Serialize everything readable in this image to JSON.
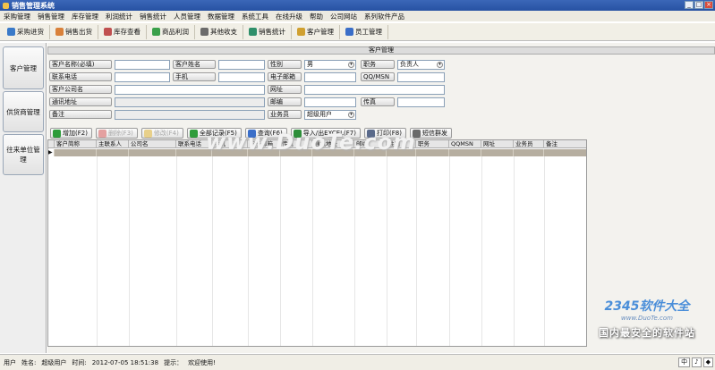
{
  "window": {
    "title": "销售管理系统",
    "buttons": [
      "_",
      "□",
      "×"
    ]
  },
  "menu": [
    "采购管理",
    "销售管理",
    "库存管理",
    "利润统计",
    "销售统计",
    "人员管理",
    "数据管理",
    "系统工具",
    "在线升级",
    "帮助",
    "公司网站",
    "系列软件产品"
  ],
  "toolbar": [
    {
      "label": "采购进货",
      "icon": "purchase-icon",
      "color": "#3a7ac8"
    },
    {
      "label": "销售出货",
      "icon": "sales-out-icon",
      "color": "#d9813a"
    },
    {
      "label": "库存查看",
      "icon": "warehouse-icon",
      "color": "#c05050"
    },
    {
      "label": "商品利润",
      "icon": "profit-icon",
      "color": "#3aa04a"
    },
    {
      "label": "其他收支",
      "icon": "wallet-icon",
      "color": "#6b6b6b"
    },
    {
      "label": "销售统计",
      "icon": "stats-icon",
      "color": "#2f8f6a"
    },
    {
      "label": "客户管理",
      "icon": "customer-icon",
      "color": "#d0a030"
    },
    {
      "label": "员工管理",
      "icon": "employee-icon",
      "color": "#3a6ec8"
    }
  ],
  "sidebar": [
    "客户管理",
    "供货商管理",
    "往来单位管理"
  ],
  "form": {
    "header": "客户管理",
    "labels": {
      "name": "客户名称(必填)",
      "contact": "客户姓名",
      "gender": "性别",
      "position": "职务",
      "phone": "联系电话",
      "mobile": "手机",
      "email": "电子邮箱",
      "qq": "QQ/MSN",
      "company": "客户公司名",
      "website": "网址",
      "address": "通讯地址",
      "zip": "邮编",
      "fax": "传真",
      "remark": "备注",
      "salesman": "业务员"
    },
    "values": {
      "gender": "男",
      "position": "负责人",
      "salesman": "超级用户"
    }
  },
  "actions": [
    {
      "label": "增加(F2)",
      "icon": "add-icon",
      "color": "#2e9c3a",
      "enabled": true
    },
    {
      "label": "删除(F3)",
      "icon": "delete-icon",
      "color": "#c83a3a",
      "enabled": false
    },
    {
      "label": "修改(F4)",
      "icon": "edit-icon",
      "color": "#d0a030",
      "enabled": false
    },
    {
      "label": "全部记录(F5)",
      "icon": "all-records-icon",
      "color": "#2e9c3a",
      "enabled": true
    },
    {
      "label": "查询(F6)",
      "icon": "search-icon",
      "color": "#3a6ec8",
      "enabled": true
    },
    {
      "label": "导入/出EXCEL(F7)",
      "icon": "excel-icon",
      "color": "#2e8f3a",
      "enabled": true
    },
    {
      "label": "打印(F8)",
      "icon": "print-icon",
      "color": "#5a6a8a",
      "enabled": true
    },
    {
      "label": "短信群发",
      "icon": "sms-icon",
      "color": "#6a6a6a",
      "enabled": true
    }
  ],
  "grid": {
    "columns": [
      "客户简称",
      "主联系人",
      "公司名",
      "联系电话",
      "手机",
      "电子邮箱",
      "传真",
      "通讯地址",
      "邮编",
      "性别",
      "职务",
      "QQMSN",
      "网址",
      "业务员",
      "备注"
    ]
  },
  "watermark": "www.DuoTe.com",
  "logo": {
    "brand": "2345软件大全",
    "url": "www.DuoTe.com",
    "slogan": "国内最安全的软件站"
  },
  "status": {
    "user_label": "用户",
    "name_label": "姓名:",
    "user_value": "超级用户",
    "time_label": "时间:",
    "time_value": "2012-07-05 18:51:38",
    "tip_label": "提示：",
    "tip_value": "欢迎使用!",
    "tray": [
      "中",
      "♪",
      "◆"
    ]
  }
}
